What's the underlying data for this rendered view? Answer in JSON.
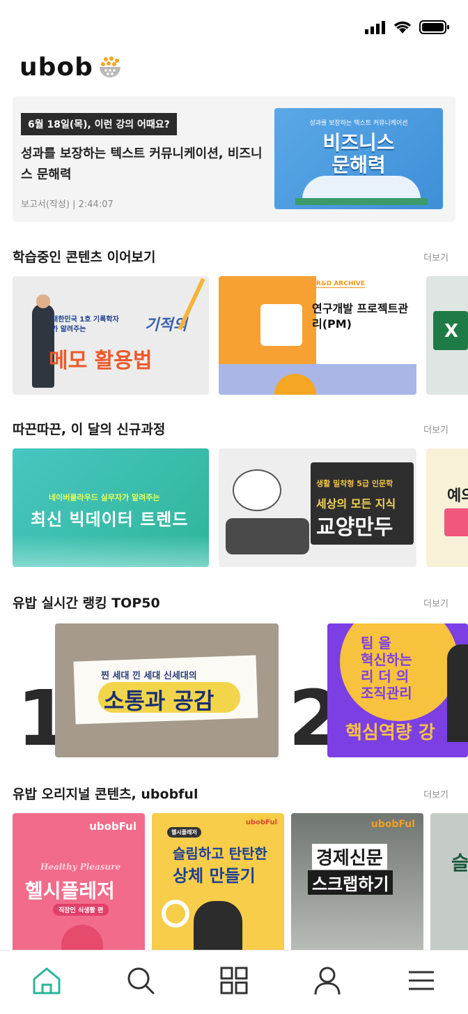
{
  "brand": {
    "logo": "ubob"
  },
  "hero": {
    "date_badge": "6월 18일(목), 이런 강의 어때요?",
    "title": "성과를 보장하는 텍스트 커뮤니케이션, 비즈니스 문해력",
    "meta": "보고서(작성)  |  2:44:07",
    "thumb_subtitle": "성과를 보장하는 텍스트 커뮤니케이션",
    "thumb_title": "비즈니스 문해력"
  },
  "sections": {
    "continue": {
      "title": "학습중인 콘텐츠 이어보기",
      "more": "더보기"
    },
    "new": {
      "title": "따끈따끈, 이 달의 신규과정",
      "more": "더보기"
    },
    "ranking": {
      "title": "유밥 실시간 랭킹 TOP50",
      "more": "더보기"
    },
    "originals": {
      "title": "유밥 오리지널 콘텐츠, ubobful",
      "more": "더보기"
    }
  },
  "continue_cards": [
    {
      "sub": "대한민국 1호 기록학자가 알려주는",
      "script": "기적의",
      "title": "메모 활용법"
    },
    {
      "tag": "R&D ARCHIVE",
      "title": "연구개발 프로젝트관리(PM)"
    },
    {
      "title": "X"
    }
  ],
  "new_cards": [
    {
      "sub": "네이버클라우드 실무자가 알려주는",
      "title": "최신 빅데이터 트렌드"
    },
    {
      "sub": "생활 밀착형 5급 인문학",
      "title1": "세상의 모든 지식",
      "title2": "교양만두"
    },
    {
      "title": "예의 바"
    }
  ],
  "ranking_items": [
    {
      "rank": "1",
      "sub": "찐 세대 낀 세대 신세대의",
      "title": "소통과 공감"
    },
    {
      "rank": "2",
      "lines": [
        "팀 을",
        "혁신하는",
        "리 더 의",
        "조직관리"
      ],
      "title": "핵심역량 강"
    }
  ],
  "original_cards": [
    {
      "brand": "ubobFul",
      "script": "Healthy Pleasure",
      "title": "헬시플레저",
      "sub": "직장인 식생활 편"
    },
    {
      "brand": "ubobFul",
      "tag": "헬시플레저",
      "title1": "슬림하고 탄탄한",
      "title2": "상체 만들기"
    },
    {
      "brand": "ubobFul",
      "title1": "경제신문",
      "title2": "스크랩하기"
    },
    {
      "title": "슬"
    }
  ],
  "nav": [
    "home-icon",
    "search-icon",
    "category-icon",
    "profile-icon",
    "menu-icon"
  ],
  "colors": {
    "accent": "#2bb59a",
    "text": "#1a1a1a",
    "muted": "#8d8d8d"
  }
}
